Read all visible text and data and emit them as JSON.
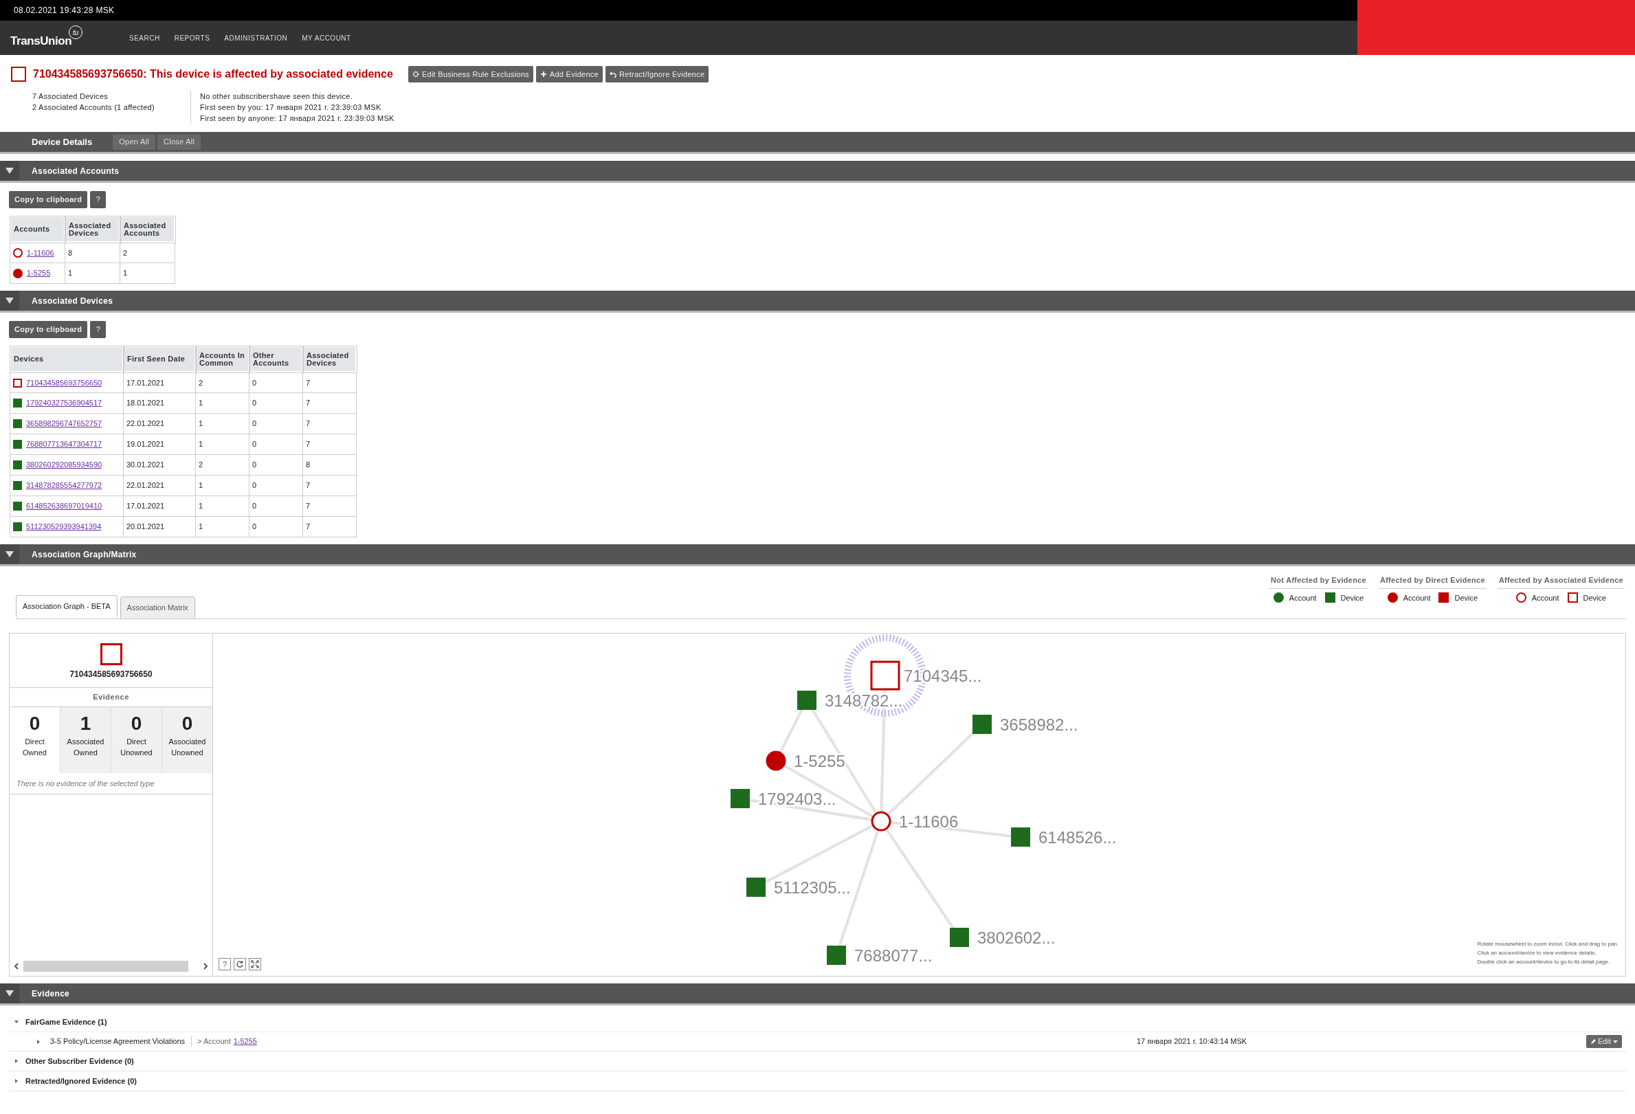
{
  "clock": "08.02.2021 19:43:28 MSK",
  "brand": {
    "name": "TransUnion",
    "mark": "tu"
  },
  "nav": [
    "SEARCH",
    "REPORTS",
    "ADMINISTRATION",
    "MY ACCOUNT"
  ],
  "device_header": {
    "color": "#c00000",
    "filled": false,
    "title": "710434585693756650: This device is affected by associated evidence",
    "actions": [
      {
        "label": "Edit Business Rule Exclusions",
        "kind": "gear"
      },
      {
        "label": "Add Evidence",
        "kind": "plus"
      },
      {
        "label": "Retract/Ignore Evidence",
        "kind": "undo"
      }
    ]
  },
  "summary_left": [
    "7 Associated Devices",
    "2 Associated Accounts (1 affected)"
  ],
  "summary_right": [
    "No other subscribershave seen this device.",
    "First seen by you:  17 января 2021 г. 23:39:03 MSK",
    "First seen by anyone:  17 января 2021 г. 23:39:03 MSK"
  ],
  "device_details": {
    "title": "Device Details",
    "buttons": [
      "Open All",
      "Close All"
    ]
  },
  "accounts": {
    "title": "Associated Accounts",
    "expanded": true,
    "copy_button": "Copy to clipboard",
    "help_button": "?",
    "columns": [
      "Accounts",
      "Associated Devices",
      "Associated Accounts"
    ],
    "rows": [
      {
        "account": "1-11606",
        "color": "#c00000",
        "filled": false,
        "devices": "8",
        "accounts": "2"
      },
      {
        "account": "1-5255",
        "color": "#c00000",
        "filled": true,
        "devices": "1",
        "accounts": "1"
      }
    ]
  },
  "devices": {
    "title": "Associated Devices",
    "expanded": true,
    "copy_button": "Copy to clipboard",
    "help_button": "?",
    "columns": [
      "Devices",
      "First Seen Date",
      "Accounts In Common",
      "Other Accounts",
      "Associated Devices"
    ],
    "rows": [
      {
        "device": "710434585693756650",
        "color": "#c00000",
        "filled": false,
        "first_seen": "17.01.2021",
        "in_common": "2",
        "other": "0",
        "associated": "7"
      },
      {
        "device": "179240327536904517",
        "color": "#1e6b1e",
        "filled": true,
        "first_seen": "18.01.2021",
        "in_common": "1",
        "other": "0",
        "associated": "7"
      },
      {
        "device": "365898296747652757",
        "color": "#1e6b1e",
        "filled": true,
        "first_seen": "22.01.2021",
        "in_common": "1",
        "other": "0",
        "associated": "7"
      },
      {
        "device": "768807713647304717",
        "color": "#1e6b1e",
        "filled": true,
        "first_seen": "19.01.2021",
        "in_common": "1",
        "other": "0",
        "associated": "7"
      },
      {
        "device": "380260292085934590",
        "color": "#1e6b1e",
        "filled": true,
        "first_seen": "30.01.2021",
        "in_common": "2",
        "other": "0",
        "associated": "8"
      },
      {
        "device": "314878285554277972",
        "color": "#1e6b1e",
        "filled": true,
        "first_seen": "22.01.2021",
        "in_common": "1",
        "other": "0",
        "associated": "7"
      },
      {
        "device": "614852638697019410",
        "color": "#1e6b1e",
        "filled": true,
        "first_seen": "17.01.2021",
        "in_common": "1",
        "other": "0",
        "associated": "7"
      },
      {
        "device": "511230529393941394",
        "color": "#1e6b1e",
        "filled": true,
        "first_seen": "20.01.2021",
        "in_common": "1",
        "other": "0",
        "associated": "7"
      }
    ]
  },
  "association": {
    "title": "Association Graph/Matrix",
    "expanded": true,
    "legend": [
      {
        "title": "Not Affected by Evidence",
        "color": "#1e6b1e",
        "filled": true,
        "items": [
          {
            "label": "Account",
            "kind": "account"
          },
          {
            "label": "Device",
            "kind": "device"
          }
        ]
      },
      {
        "title": "Affected by Direct Evidence",
        "color": "#c00000",
        "filled": true,
        "items": [
          {
            "label": "Account",
            "kind": "account"
          },
          {
            "label": "Device",
            "kind": "device"
          }
        ]
      },
      {
        "title": "Affected by Associated Evidence",
        "color": "#c00000",
        "filled": false,
        "items": [
          {
            "label": "Account",
            "kind": "account"
          },
          {
            "label": "Device",
            "kind": "device"
          }
        ]
      }
    ],
    "tabs": [
      {
        "label": "Association Graph - BETA",
        "selected": true
      },
      {
        "label": "Association Matrix",
        "selected": false
      }
    ],
    "panel": {
      "node": "710434585693756650",
      "color": "#c00000",
      "filled": false,
      "heading": "Evidence",
      "counters": [
        {
          "count": "0",
          "label": "Direct Owned",
          "selected": true
        },
        {
          "count": "1",
          "label": "Associated Owned",
          "selected": false
        },
        {
          "count": "0",
          "label": "Direct Unowned",
          "selected": false
        },
        {
          "count": "0",
          "label": "Associated Unowned",
          "selected": false
        }
      ],
      "message": "There is no evidence of the selected type"
    },
    "controls": {
      "help": "?"
    },
    "nodes": [
      {
        "label": "7104345...",
        "kind": "device",
        "color": "#c00000",
        "filled": false,
        "selected": true
      },
      {
        "label": "3148782...",
        "kind": "device",
        "color": "#1e6b1e",
        "filled": true,
        "selected": false
      },
      {
        "label": "3658982...",
        "kind": "device",
        "color": "#1e6b1e",
        "filled": true,
        "selected": false
      },
      {
        "label": "1-5255",
        "kind": "account",
        "color": "#c00000",
        "filled": true,
        "selected": false
      },
      {
        "label": "1792403...",
        "kind": "device",
        "color": "#1e6b1e",
        "filled": true,
        "selected": false
      },
      {
        "label": "1-11606",
        "kind": "account",
        "color": "#c00000",
        "filled": false,
        "selected": false
      },
      {
        "label": "6148526...",
        "kind": "device",
        "color": "#1e6b1e",
        "filled": true,
        "selected": false
      },
      {
        "label": "5112305...",
        "kind": "device",
        "color": "#1e6b1e",
        "filled": true,
        "selected": false
      },
      {
        "label": "3802602...",
        "kind": "device",
        "color": "#1e6b1e",
        "filled": true,
        "selected": false
      },
      {
        "label": "7688077...",
        "kind": "device",
        "color": "#1e6b1e",
        "filled": true,
        "selected": false
      }
    ],
    "hint": [
      "Rotate mousewheel to zoom in/out. Click and drag to pan.",
      "Click an account/device to view evidence details.",
      "Double click an account/device to go to its detail page."
    ]
  },
  "evidence": {
    "title": "Evidence",
    "expanded": true,
    "groups": [
      {
        "title": "FairGame Evidence (1)",
        "expanded": true,
        "items": [
          {
            "name": "3-5 Policy/License Agreement Violations",
            "expanded": false,
            "path": "> Account",
            "link": "1-5255",
            "date": "17 января 2021 г. 10:43:14 MSK",
            "action": "Edit"
          }
        ]
      },
      {
        "title": "Other Subscriber Evidence (0)",
        "expanded": false
      },
      {
        "title": "Retracted/Ignored Evidence (0)",
        "expanded": false
      }
    ]
  }
}
